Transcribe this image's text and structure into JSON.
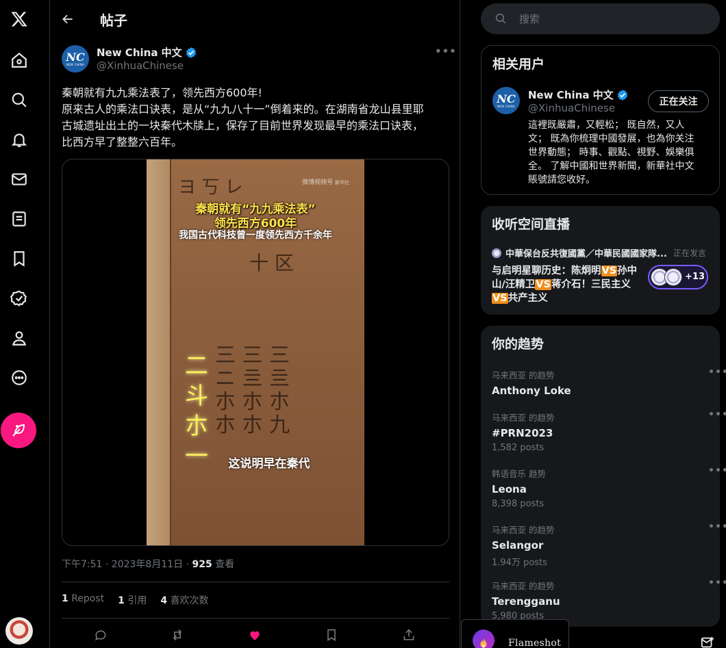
{
  "header": {
    "title": "帖子"
  },
  "post": {
    "author_name": "New China 中文",
    "author_handle": "@XinhuaChinese",
    "avatar_logo": "NC",
    "avatar_sub": "NEW CHINA",
    "text_lines": [
      "秦朝就有九九乘法表了，领先西方600年!",
      "原来古人的乘法口诀表，是从“九九八十一”倒着来的。在湖南省龙山县里耶",
      "古城遗址出土的一块秦代木牍上，保存了目前世界发现最早的乘法口诀表，",
      "比西方早了整整六百年。"
    ],
    "video": {
      "watermark": "微博视频号",
      "watermark_sub": "新华社",
      "caption_line1": "秦朝就有“九九乘法表”",
      "caption_line2": "领先西方600年",
      "caption_line3": "我国古代科技曾一度领先西方千余年",
      "subtitle": "这说明早在秦代"
    },
    "timestamp": "下午7:51 · 2023年8月11日 · ",
    "views_count": "925",
    "views_label": " 查看",
    "reposts_count": "1",
    "reposts_label": "Repost",
    "quotes_count": "1",
    "quotes_label": "引用",
    "likes_count": "4",
    "likes_label": "喜欢次数"
  },
  "search": {
    "placeholder": "搜索"
  },
  "related": {
    "title": "相关用户",
    "user_name": "New China 中文",
    "user_handle": "@XinhuaChinese",
    "follow_label": "正在关注",
    "bio_lines": [
      "這裡既嚴肅，又輕松；  既自然，又人",
      "文；  既為你梳理中國發展，也為你关注",
      "世界動態；  時事、觀點、視野、娛樂俱",
      "全。 了解中國和世界新聞，新華社中文",
      "賬號請您收好。"
    ]
  },
  "spaces": {
    "title": "收听空间直播",
    "host": "中華保台反共復國黨／中華民國國家隊...",
    "status": "正在发言",
    "title_parts": [
      "与启明星聊历史：陈炯明",
      "VS",
      "孙中山/汪精卫",
      "VS",
      "蒋介石！三民主义",
      "VS",
      "共产主义"
    ],
    "listener_count": "+13"
  },
  "trends": {
    "title": "你的趋势",
    "items": [
      {
        "meta": "马来西亚 的趋势",
        "name": "Anthony Loke",
        "posts": ""
      },
      {
        "meta": "马来西亚 的趋势",
        "name": "#PRN2023",
        "posts": "1,582 posts"
      },
      {
        "meta": "韩语音乐 趋势",
        "name": "Leona",
        "posts": "8,398 posts"
      },
      {
        "meta": "马来西亚 的趋势",
        "name": "Selangor",
        "posts": "1.94万 posts"
      },
      {
        "meta": "马来西亚 的趋势",
        "name": "Terengganu",
        "posts": "5,980 posts"
      }
    ]
  },
  "taskbar": {
    "app_label": "Flameshot"
  },
  "colors": {
    "accent": "#1d9bf0",
    "post_button": "#f91880",
    "like": "#f91880",
    "vs_badge": "#f08e1b",
    "bg": "#000000"
  },
  "icons": [
    "x-logo-icon",
    "home-icon",
    "search-icon",
    "bell-icon",
    "mail-icon",
    "lists-icon",
    "bookmark-icon",
    "verified-org-icon",
    "profile-icon",
    "more-circle-icon",
    "feather-icon",
    "back-arrow-icon",
    "verified-badge-icon",
    "reply-icon",
    "repost-icon",
    "heart-icon",
    "bookmark-icon",
    "share-icon"
  ]
}
